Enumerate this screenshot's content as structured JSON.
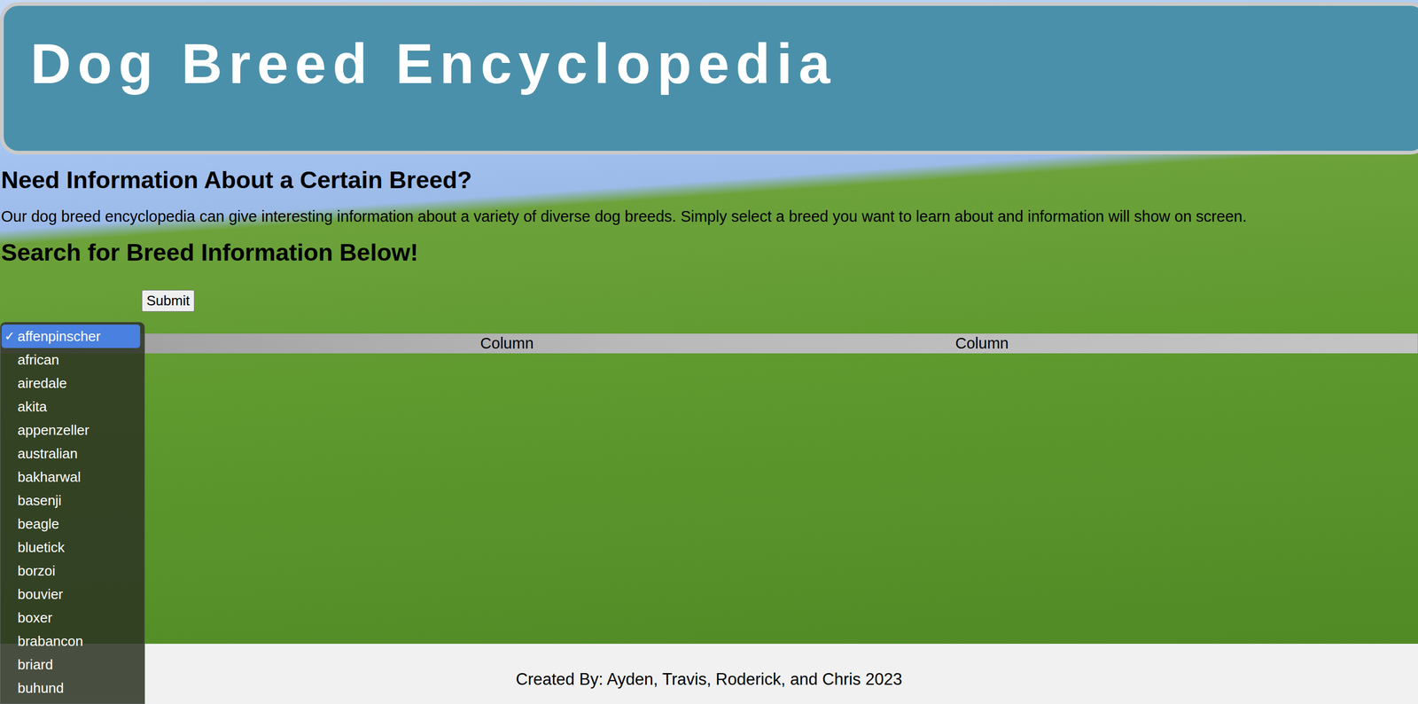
{
  "header": {
    "title": "Dog Breed Encyclopedia"
  },
  "intro": {
    "heading": "Need Information About a Certain Breed?",
    "text": "Our dog breed encyclopedia can give interesting information about a variety of diverse dog breeds. Simply select a breed you want to learn about and information will show on screen."
  },
  "search": {
    "heading": "Search for Breed Information Below!",
    "submit": "Submit",
    "dropdown": {
      "open": true,
      "check": "✓",
      "options": [
        {
          "label": "affenpinscher",
          "selected": true
        },
        {
          "label": "african",
          "selected": false
        },
        {
          "label": "airedale",
          "selected": false
        },
        {
          "label": "akita",
          "selected": false
        },
        {
          "label": "appenzeller",
          "selected": false
        },
        {
          "label": "australian",
          "selected": false
        },
        {
          "label": "bakharwal",
          "selected": false
        },
        {
          "label": "basenji",
          "selected": false
        },
        {
          "label": "beagle",
          "selected": false
        },
        {
          "label": "bluetick",
          "selected": false
        },
        {
          "label": "borzoi",
          "selected": false
        },
        {
          "label": "bouvier",
          "selected": false
        },
        {
          "label": "boxer",
          "selected": false
        },
        {
          "label": "brabancon",
          "selected": false
        },
        {
          "label": "briard",
          "selected": false
        },
        {
          "label": "buhund",
          "selected": false
        }
      ]
    }
  },
  "table": {
    "columns": [
      "Column",
      "Column"
    ]
  },
  "footer": {
    "text": "Created By: Ayden, Travis, Roderick, and Chris 2023"
  }
}
